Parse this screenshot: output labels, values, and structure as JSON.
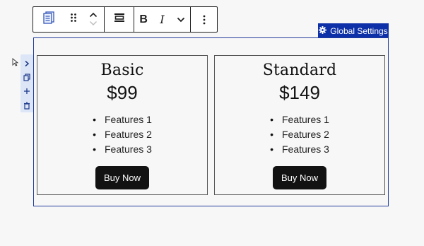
{
  "toolbar": {
    "block_icon": "document-stack-icon",
    "drag_icon": "drag-handle-icon",
    "move_up_icon": "chevron-up-icon",
    "move_down_icon": "chevron-down-icon",
    "align_icon": "align-icon",
    "bold_label": "B",
    "italic_label": "I",
    "more_rich_text_icon": "chevron-down-icon",
    "options_icon": "vertical-ellipsis-icon"
  },
  "side_controls": {
    "expand_icon": "chevron-right-icon",
    "duplicate_icon": "duplicate-icon",
    "add_icon": "plus-icon",
    "delete_icon": "trash-icon"
  },
  "global_settings": {
    "label": "Global Settings",
    "icon": "gear-icon"
  },
  "pricing": {
    "cards": [
      {
        "plan": "Basic",
        "price": "$99",
        "features": [
          "Features 1",
          "Features 2",
          "Features 3"
        ],
        "button": "Buy Now"
      },
      {
        "plan": "Standard",
        "price": "$149",
        "features": [
          "Features 1",
          "Features 2",
          "Features 3"
        ],
        "button": "Buy Now"
      }
    ]
  },
  "colors": {
    "accent": "#0d2fa7",
    "outline": "#213b9c",
    "button_bg": "#121212",
    "side_bg": "#dce6f7"
  }
}
